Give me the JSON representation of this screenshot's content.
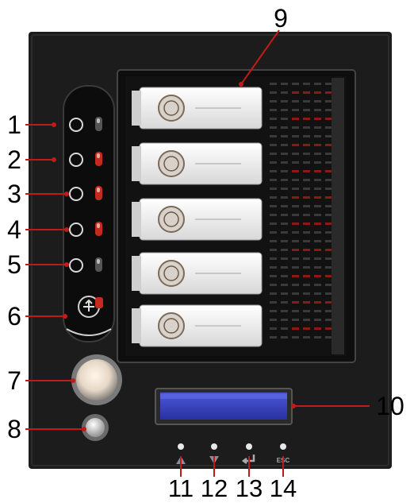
{
  "callouts": [
    "1",
    "2",
    "3",
    "4",
    "5",
    "6",
    "7",
    "8",
    "9",
    "10",
    "11",
    "12",
    "13",
    "14"
  ],
  "button_labels": {
    "esc": "ESC"
  },
  "icons": {
    "led1": "power-status-icon",
    "led2": "network-icon",
    "led3": "hdd-activity-icon",
    "led4": "disk-icon",
    "led5": "warning-icon",
    "led6": "usb-icon",
    "btn11": "arrow-up-icon",
    "btn12": "arrow-down-icon",
    "btn13": "enter-icon",
    "btn14": "esc-icon"
  },
  "colors": {
    "chassis": "#1c1c1c",
    "bay_frame": "#0e0e0e",
    "drive_tray": "#f2f2f2",
    "lcd": "#3a45c8",
    "led_red": "#c42a1e",
    "callout": "#c21a1a"
  }
}
